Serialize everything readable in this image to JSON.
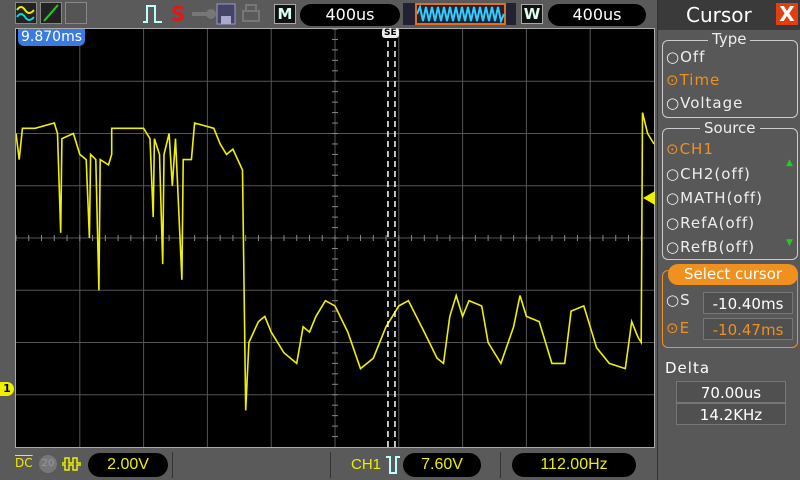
{
  "toolbar": {
    "timebase_label": "M",
    "timebase": "400us",
    "window_label": "W",
    "window": "400us",
    "stop_indicator": "S"
  },
  "screen": {
    "time_offset": "9.870ms",
    "trigger_marker": "SE",
    "ground_marker": "1"
  },
  "bottom": {
    "coupling": "DC",
    "bw_limit": "20",
    "ch1_scale": "2.00V",
    "trigger_source": "CH1",
    "trigger_level": "7.60V",
    "frequency": "112.00Hz"
  },
  "colors": {
    "ch1": "#f0f000",
    "accent": "#f0901e",
    "close": "#e04010",
    "marker": "#3a7be0"
  },
  "panel": {
    "title": "Cursor",
    "close": "X",
    "type_label": "Type",
    "type_options": [
      "Off",
      "Time",
      "Voltage"
    ],
    "type_selected": 1,
    "source_label": "Source",
    "source_options": [
      "CH1",
      "CH2(off)",
      "MATH(off)",
      "RefA(off)",
      "RefB(off)"
    ],
    "source_selected": 0,
    "select_label": "Select cursor",
    "s_label": "S",
    "s_value": "-10.40ms",
    "e_label": "E",
    "e_value": "-10.47ms",
    "delta_label": "Delta",
    "delta_time": "70.00us",
    "delta_freq": "14.2KHz"
  },
  "trace_divs": [
    [
      0,
      2.0
    ],
    [
      0.05,
      1.5
    ],
    [
      0.1,
      2.1
    ],
    [
      0.3,
      2.1
    ],
    [
      0.6,
      2.2
    ],
    [
      0.65,
      2.0
    ],
    [
      0.7,
      0.1
    ],
    [
      0.72,
      1.9
    ],
    [
      0.9,
      2.0
    ],
    [
      1.0,
      1.6
    ],
    [
      1.1,
      1.5
    ],
    [
      1.15,
      0.0
    ],
    [
      1.17,
      1.6
    ],
    [
      1.25,
      1.5
    ],
    [
      1.3,
      -1.0
    ],
    [
      1.32,
      1.5
    ],
    [
      1.45,
      1.4
    ],
    [
      1.5,
      1.6
    ],
    [
      1.5,
      2.1
    ],
    [
      2.0,
      2.1
    ],
    [
      2.1,
      1.9
    ],
    [
      2.15,
      0.4
    ],
    [
      2.17,
      1.9
    ],
    [
      2.25,
      1.6
    ],
    [
      2.3,
      -0.5
    ],
    [
      2.32,
      1.6
    ],
    [
      2.4,
      2.0
    ],
    [
      2.45,
      1.0
    ],
    [
      2.5,
      1.9
    ],
    [
      2.6,
      -0.8
    ],
    [
      2.62,
      1.5
    ],
    [
      2.75,
      1.5
    ],
    [
      2.8,
      2.2
    ],
    [
      3.1,
      2.1
    ],
    [
      3.2,
      1.8
    ],
    [
      3.3,
      1.6
    ],
    [
      3.4,
      1.7
    ],
    [
      3.55,
      1.3
    ],
    [
      3.6,
      -3.3
    ],
    [
      3.65,
      -2.0
    ],
    [
      3.8,
      -1.6
    ],
    [
      3.9,
      -1.5
    ],
    [
      4.0,
      -1.8
    ],
    [
      4.2,
      -2.2
    ],
    [
      4.4,
      -2.4
    ],
    [
      4.5,
      -1.7
    ],
    [
      4.6,
      -1.8
    ],
    [
      4.7,
      -1.5
    ],
    [
      4.85,
      -1.2
    ],
    [
      5.0,
      -1.3
    ],
    [
      5.2,
      -1.8
    ],
    [
      5.4,
      -2.5
    ],
    [
      5.6,
      -2.3
    ],
    [
      5.8,
      -1.7
    ],
    [
      5.9,
      -1.5
    ],
    [
      6.0,
      -1.3
    ],
    [
      6.15,
      -1.2
    ],
    [
      6.4,
      -1.8
    ],
    [
      6.6,
      -2.3
    ],
    [
      6.7,
      -2.4
    ],
    [
      6.8,
      -1.5
    ],
    [
      6.9,
      -1.1
    ],
    [
      7.0,
      -1.5
    ],
    [
      7.1,
      -1.2
    ],
    [
      7.3,
      -1.3
    ],
    [
      7.4,
      -2.0
    ],
    [
      7.6,
      -2.4
    ],
    [
      7.8,
      -1.7
    ],
    [
      7.9,
      -1.1
    ],
    [
      8.0,
      -1.5
    ],
    [
      8.2,
      -1.6
    ],
    [
      8.4,
      -2.4
    ],
    [
      8.6,
      -2.4
    ],
    [
      8.7,
      -1.4
    ],
    [
      8.9,
      -1.3
    ],
    [
      9.1,
      -2.1
    ],
    [
      9.3,
      -2.4
    ],
    [
      9.55,
      -2.5
    ],
    [
      9.65,
      -1.6
    ],
    [
      9.75,
      -1.9
    ],
    [
      9.8,
      -2.0
    ],
    [
      9.82,
      2.4
    ],
    [
      9.9,
      2.0
    ],
    [
      10,
      1.8
    ]
  ],
  "cursor_divs": {
    "s": 5.83,
    "e": 5.94
  },
  "trigger_level_div": 0.75,
  "ground_div": -2.9
}
